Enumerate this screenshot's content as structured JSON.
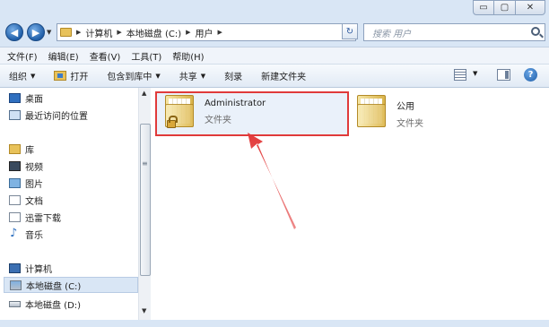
{
  "window": {
    "caption": {
      "minimize": "▭",
      "maximize": "▢",
      "close": "✕"
    }
  },
  "address_bar": {
    "breadcrumbs": [
      "计算机",
      "本地磁盘 (C:)",
      "用户"
    ],
    "search_placeholder": "搜索 用户"
  },
  "menubar": {
    "items": [
      "文件(F)",
      "编辑(E)",
      "查看(V)",
      "工具(T)",
      "帮助(H)"
    ]
  },
  "toolbar": {
    "organize": "组织",
    "open": "打开",
    "include_in_library": "包含到库中",
    "share": "共享",
    "burn": "刻录",
    "new_folder": "新建文件夹",
    "help_glyph": "?"
  },
  "nav_pane": {
    "favorites": [
      {
        "label": "桌面",
        "icon": "desktop-icon"
      },
      {
        "label": "最近访问的位置",
        "icon": "recent-places-icon"
      }
    ],
    "library": {
      "label": "库",
      "icon": "library-icon"
    },
    "library_items": [
      {
        "label": "视频",
        "icon": "video-icon"
      },
      {
        "label": "图片",
        "icon": "picture-icon"
      },
      {
        "label": "文档",
        "icon": "document-icon"
      },
      {
        "label": "迅雷下载",
        "icon": "download-icon"
      },
      {
        "label": "音乐",
        "icon": "music-icon"
      }
    ],
    "computer": {
      "label": "计算机",
      "icon": "computer-icon"
    },
    "drives": [
      {
        "label": "本地磁盘 (C:)",
        "icon": "drive-c-icon",
        "selected": true
      },
      {
        "label": "本地磁盘 (D:)",
        "icon": "drive-icon"
      }
    ]
  },
  "content": {
    "items": [
      {
        "name": "Administrator",
        "type": "文件夹",
        "locked": true,
        "highlighted": true
      },
      {
        "name": "公用",
        "type": "文件夹",
        "locked": false,
        "highlighted": false
      }
    ]
  },
  "colors": {
    "highlight_border": "#e03a3a",
    "annotation_arrow": "#e23b3b"
  }
}
